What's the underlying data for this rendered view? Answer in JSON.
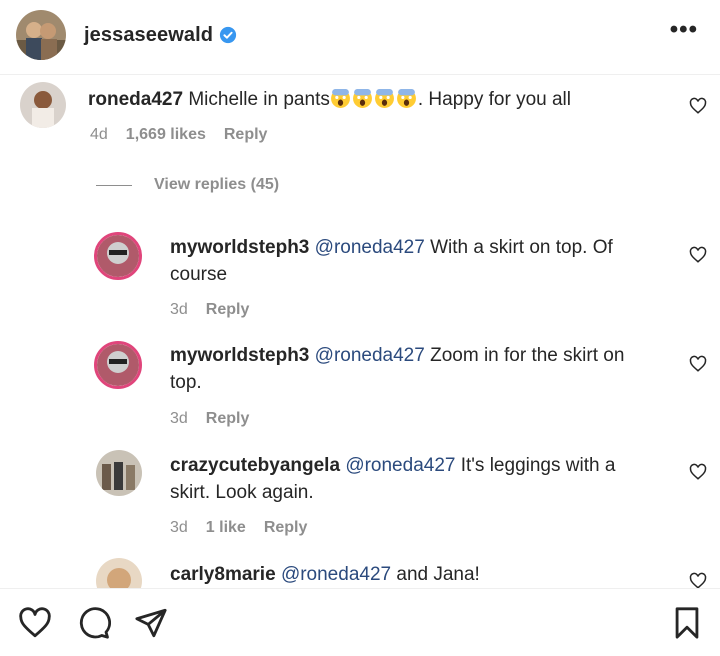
{
  "header": {
    "username": "jessaseewald",
    "verified_icon": "verified-badge-icon",
    "more_label": "•••"
  },
  "comment": {
    "username": "roneda427",
    "text": "Michelle in pants",
    "emoji": [
      "face-screaming-in-fear",
      "face-screaming-in-fear",
      "face-screaming-in-fear",
      "face-screaming-in-fear"
    ],
    "text_after": ". Happy for you all",
    "time": "4d",
    "likes": "1,669 likes",
    "reply_label": "Reply"
  },
  "view_replies_label": "View replies (45)",
  "replies": [
    {
      "username": "myworldsteph3",
      "mention": "@roneda427",
      "text": "With a skirt on top. Of",
      "text2": "course",
      "time": "3d",
      "likes": "",
      "reply_label": "Reply"
    },
    {
      "username": "myworldsteph3",
      "mention": "@roneda427",
      "text": "Zoom in for the skirt on",
      "text2": "top.",
      "time": "3d",
      "likes": "",
      "reply_label": "Reply"
    },
    {
      "username": "crazycutebyangela",
      "mention": "@roneda427",
      "text": "It's leggings with a",
      "text2": "skirt. Look again.",
      "time": "3d",
      "likes": "1 like",
      "reply_label": "Reply"
    },
    {
      "username": "carly8marie",
      "mention": "@roneda427",
      "text": "and Jana!",
      "text2": "",
      "time": "",
      "likes": "",
      "reply_label": ""
    }
  ],
  "bottom_bar": {
    "icons": [
      "heart-icon",
      "comment-icon",
      "share-icon",
      "bookmark-icon"
    ]
  },
  "colors": {
    "mention": "#2b4a7d",
    "meta": "#8e8e8e",
    "text": "#262626"
  }
}
